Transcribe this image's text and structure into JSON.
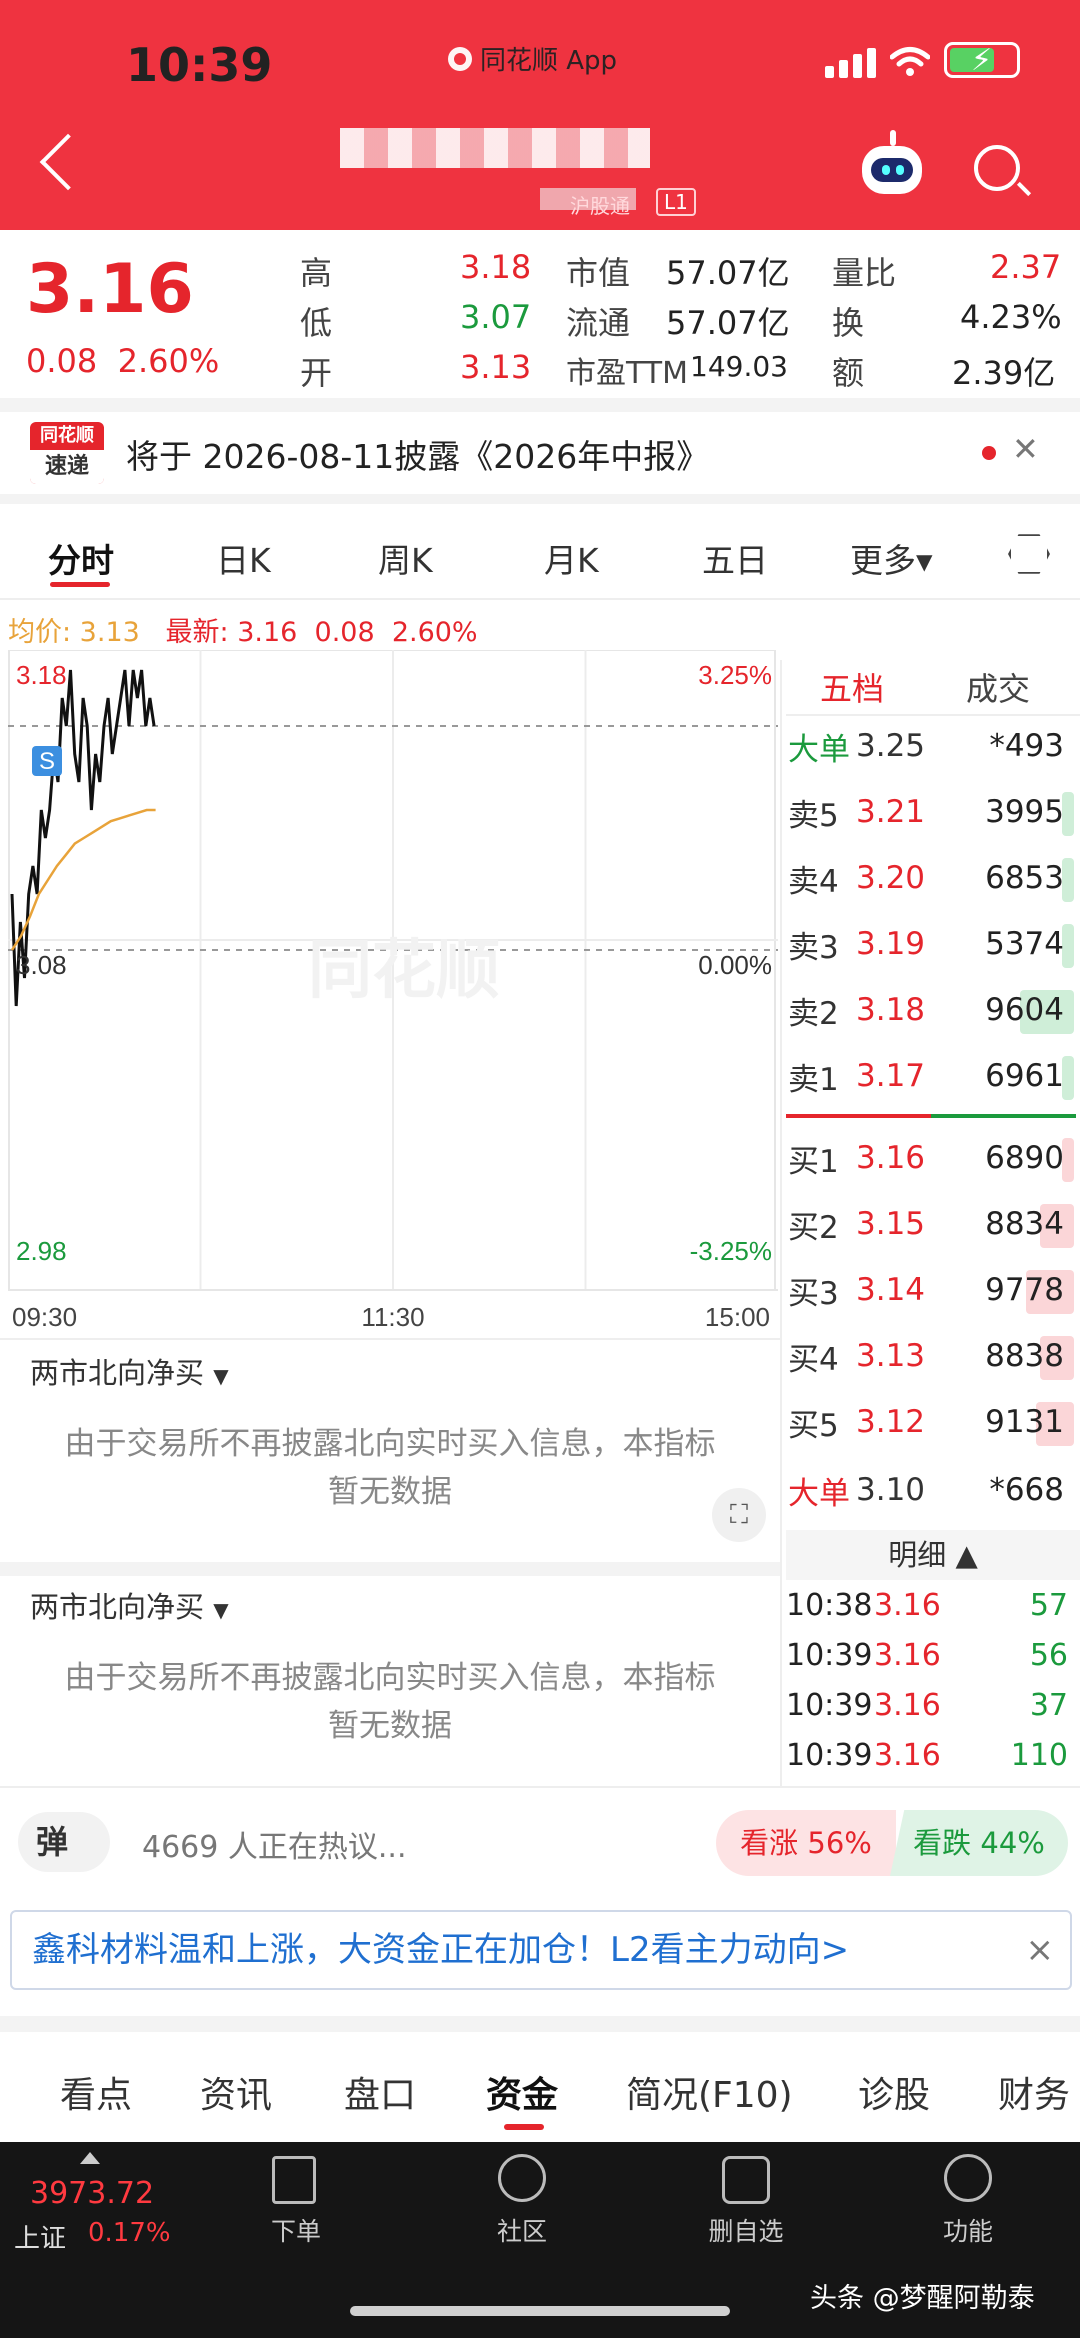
{
  "status_bar": {
    "time": "10:39",
    "app": "同花顺 App"
  },
  "header": {
    "badge_text": "沪股通",
    "level": "L1"
  },
  "quote": {
    "price": "3.16",
    "change": "0.08",
    "change_pct": "2.60%",
    "high_label": "高",
    "high": "3.18",
    "low_label": "低",
    "low": "3.07",
    "open_label": "开",
    "open": "3.13",
    "mktcap_label": "市值",
    "mktcap": "57.07亿",
    "float_label": "流通",
    "float": "57.07亿",
    "pe_label": "市盈TTM",
    "pe": "149.03",
    "volratio_label": "量比",
    "volratio": "2.37",
    "turnover_label": "换",
    "turnover": "4.23%",
    "amount_label": "额",
    "amount": "2.39亿"
  },
  "news": {
    "logo_top": "同花顺",
    "logo_bottom": "速递",
    "text": "将于 2026-08-11披露《2026年中报》"
  },
  "chart_tabs": [
    "分时",
    "日K",
    "周K",
    "月K",
    "五日",
    "更多▾"
  ],
  "avg_line": {
    "avg_label": "均价: 3.13",
    "latest_label": "最新: 3.16",
    "chg": "0.08",
    "pct": "2.60%"
  },
  "chart_data": {
    "type": "line",
    "y_left_ticks": [
      "3.18",
      "3.08",
      "2.98"
    ],
    "y_right_ticks": [
      "3.25%",
      "0.00%",
      "-3.25%"
    ],
    "x_ticks": [
      "09:30",
      "11:30",
      "15:00"
    ],
    "ylim": [
      2.98,
      3.18
    ],
    "marker": "S",
    "series": [
      {
        "values": [
          3.1,
          3.06,
          3.09,
          3.07,
          3.1,
          3.11,
          3.1,
          3.13,
          3.12,
          3.13,
          3.15,
          3.14,
          3.17,
          3.16,
          3.18,
          3.15,
          3.14,
          3.17,
          3.16,
          3.13,
          3.15,
          3.14,
          3.16,
          3.17,
          3.15,
          3.16,
          3.17,
          3.18,
          3.16,
          3.18,
          3.17,
          3.18,
          3.16,
          3.17,
          3.16
        ],
        "color": "#111111"
      },
      {
        "values": [
          3.08,
          3.085,
          3.092,
          3.1,
          3.105,
          3.11,
          3.114,
          3.118,
          3.12,
          3.122,
          3.124,
          3.126,
          3.127,
          3.128,
          3.129,
          3.13,
          3.13
        ],
        "color": "#e8a33a"
      }
    ]
  },
  "orderbook": {
    "tab_active": "五档",
    "tab_other": "成交",
    "big_sell": {
      "label": "大单",
      "price": "3.25",
      "vol": "*493"
    },
    "asks": [
      {
        "label": "卖5",
        "price": "3.21",
        "vol": "3995",
        "bar": 0.05
      },
      {
        "label": "卖4",
        "price": "3.20",
        "vol": "6853",
        "bar": 0.08
      },
      {
        "label": "卖3",
        "price": "3.19",
        "vol": "5374",
        "bar": 0.05
      },
      {
        "label": "卖2",
        "price": "3.18",
        "vol": "9604",
        "bar": 0.45
      },
      {
        "label": "卖1",
        "price": "3.17",
        "vol": "6961",
        "bar": 0.1
      }
    ],
    "bids": [
      {
        "label": "买1",
        "price": "3.16",
        "vol": "6890",
        "bar": 0.05
      },
      {
        "label": "买2",
        "price": "3.15",
        "vol": "8834",
        "bar": 0.28
      },
      {
        "label": "买3",
        "price": "3.14",
        "vol": "9778",
        "bar": 0.4
      },
      {
        "label": "买4",
        "price": "3.13",
        "vol": "8838",
        "bar": 0.28
      },
      {
        "label": "买5",
        "price": "3.12",
        "vol": "9131",
        "bar": 0.32
      }
    ],
    "big_buy": {
      "label": "大单",
      "price": "3.10",
      "vol": "*668"
    },
    "detail_header": "明细 ▲",
    "ticks": [
      {
        "time": "10:38",
        "price": "3.16",
        "vol": "57"
      },
      {
        "time": "10:39",
        "price": "3.16",
        "vol": "56"
      },
      {
        "time": "10:39",
        "price": "3.16",
        "vol": "37"
      },
      {
        "time": "10:39",
        "price": "3.16",
        "vol": "110"
      }
    ]
  },
  "panels": [
    {
      "title": "两市北向净买",
      "line1": "由于交易所不再披露北向实时买入信息，本指标",
      "line2": "暂无数据"
    },
    {
      "title": "两市北向净买",
      "line1": "由于交易所不再披露北向实时买入信息，本指标",
      "line2": "暂无数据"
    }
  ],
  "discuss": {
    "dan": "弹",
    "text": "4669 人正在热议...",
    "bull": "看涨 56%",
    "bear": "看跌 44%"
  },
  "promo": {
    "text": "鑫科材料温和上涨，大资金正在加仓！L2看主力动向>",
    "close": "×"
  },
  "bottom_tabs": [
    "看点",
    "资讯",
    "盘口",
    "资金",
    "简况(F10)",
    "诊股",
    "财务"
  ],
  "nav": {
    "index_value": "3973.72",
    "index_name": "上证",
    "index_pct": "0.17%",
    "items": [
      "下单",
      "社区",
      "删自选",
      "功能"
    ]
  },
  "watermark": "头条 @梦醒阿勒泰"
}
